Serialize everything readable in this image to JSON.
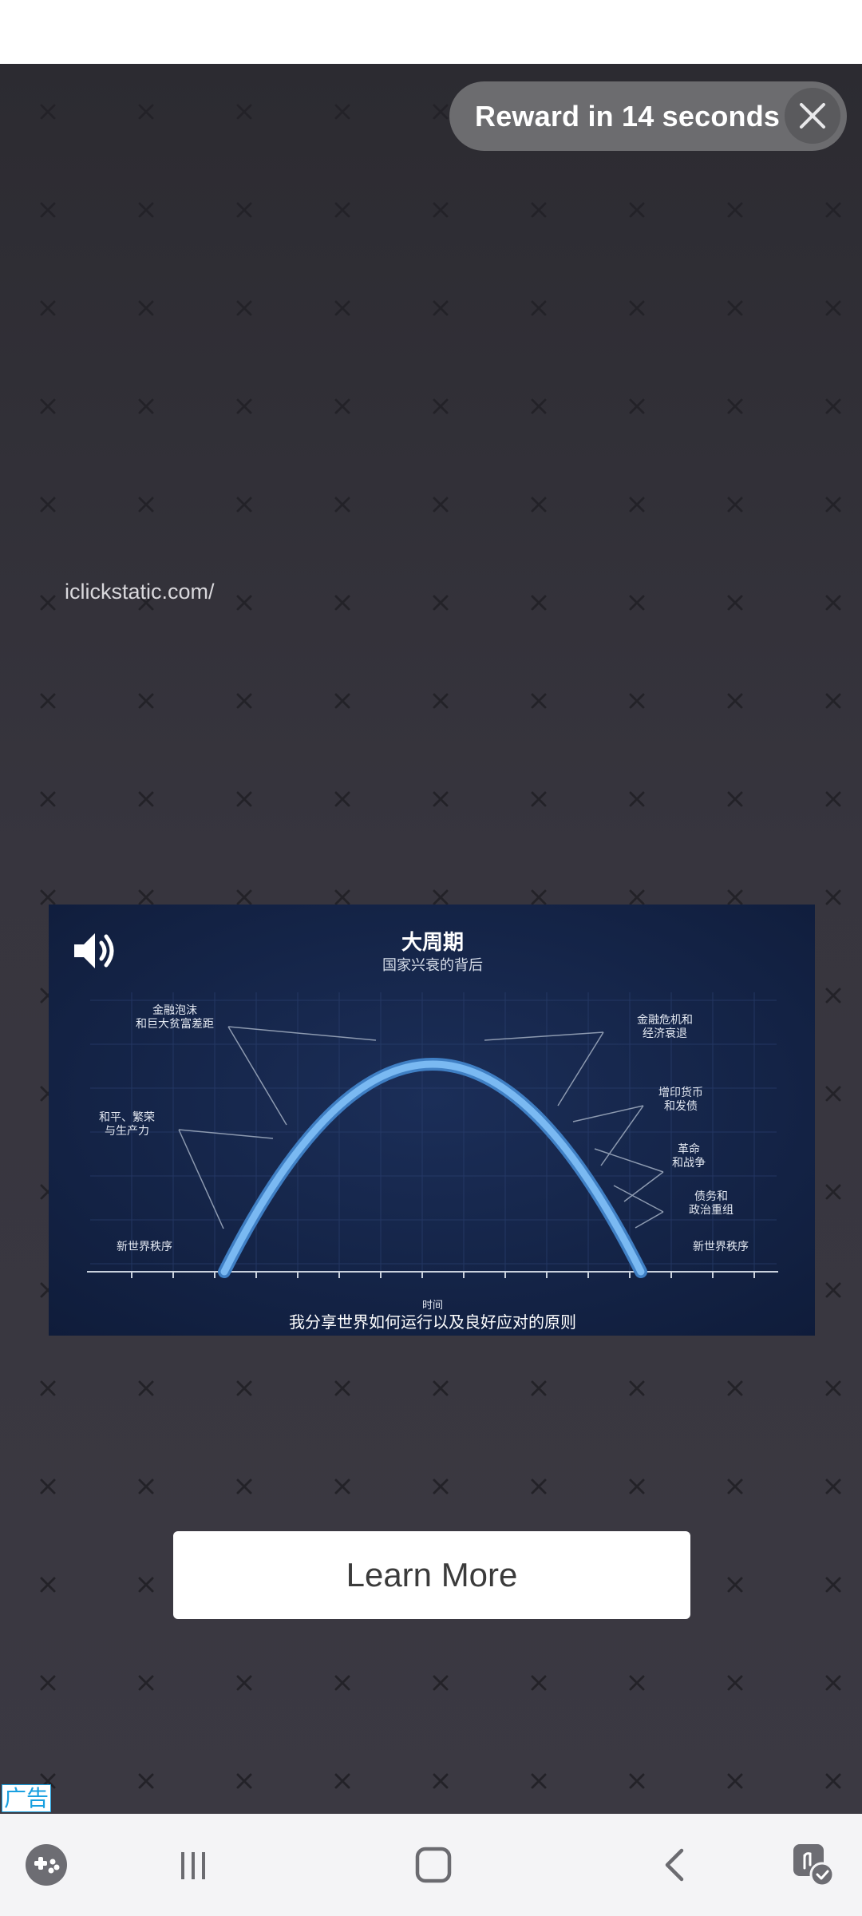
{
  "reward": {
    "label": "Reward in 14 seconds"
  },
  "ad": {
    "domain": "iclickstatic.com/",
    "cta_label": "Learn More",
    "ad_badge": "广告"
  },
  "video": {
    "title": "大周期",
    "subtitle": "国家兴衰的背后",
    "axis_label": "时间",
    "caption": "我分享世界如何运行以及良好应对的原则",
    "left_annotations": [
      "金融泡沫\n和巨大贫富差距",
      "和平、繁荣\n与生产力",
      "新世界秩序"
    ],
    "right_annotations": [
      "金融危机和\n经济衰退",
      "增印货币\n和发债",
      "革命\n和战争",
      "债务和\n政治重组",
      "新世界秩序"
    ],
    "sound_icon": "speaker-icon"
  },
  "nav": {
    "icons": [
      "game-launcher-icon",
      "recent-apps-icon",
      "home-icon",
      "back-icon",
      "assistive-touch-icon"
    ]
  },
  "colors": {
    "accent_blue": "#6aaef0",
    "background": "#37353e",
    "pill": "#6c6c6f",
    "video_bg": "#152547"
  }
}
